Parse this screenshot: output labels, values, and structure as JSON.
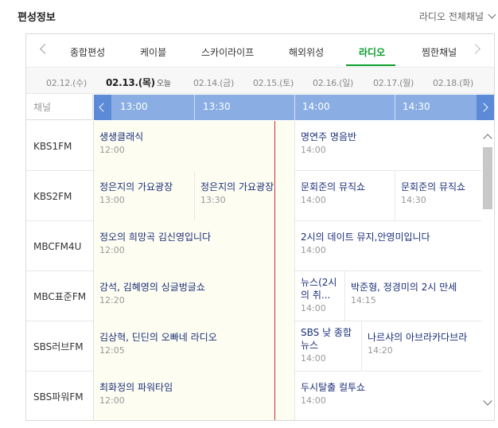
{
  "header": {
    "title": "편성정보",
    "channel_filter": "라디오 전체채널"
  },
  "tabs": [
    {
      "label": "종합편성",
      "active": false
    },
    {
      "label": "케이블",
      "active": false
    },
    {
      "label": "스카이라이프",
      "active": false
    },
    {
      "label": "해외위성",
      "active": false
    },
    {
      "label": "라디오",
      "active": true
    },
    {
      "label": "찜한채널",
      "active": false
    }
  ],
  "dates": [
    {
      "label": "02.12.(수)",
      "active": false,
      "today": ""
    },
    {
      "label": "02.13.(목)",
      "active": true,
      "today": "오늘"
    },
    {
      "label": "02.14.(금)",
      "active": false,
      "today": ""
    },
    {
      "label": "02.15.(토)",
      "active": false,
      "today": ""
    },
    {
      "label": "02.16.(일)",
      "active": false,
      "today": ""
    },
    {
      "label": "02.17.(월)",
      "active": false,
      "today": ""
    },
    {
      "label": "02.18.(화)",
      "active": false,
      "today": ""
    }
  ],
  "timebar": {
    "channel_header": "채널",
    "times": [
      "13:00",
      "13:30",
      "14:00",
      "14:30"
    ]
  },
  "channels": [
    {
      "name": "KBS1FM",
      "programs": [
        {
          "title": "생생클래식",
          "time": "12:00"
        },
        {
          "title": "명연주 명음반",
          "time": "14:00"
        }
      ]
    },
    {
      "name": "KBS2FM",
      "programs": [
        {
          "title": "정은지의 가요광장",
          "time": "13:00"
        },
        {
          "title": "정은지의 가요광장",
          "time": "13:30"
        },
        {
          "title": "문회준의 뮤직쇼",
          "time": "14:00"
        },
        {
          "title": "문회준의 뮤직쇼",
          "time": "14:30"
        }
      ]
    },
    {
      "name": "MBCFM4U",
      "programs": [
        {
          "title": "정오의 희망곡 김신영입니다",
          "time": "12:00"
        },
        {
          "title": "2시의 데이트 뮤지,안영미입니다",
          "time": "14:00"
        }
      ]
    },
    {
      "name": "MBC표준FM",
      "programs": [
        {
          "title": "강석, 김혜영의 싱글벙글쇼",
          "time": "12:20"
        },
        {
          "title": "뉴스(2시의 취...",
          "time": "14:00"
        },
        {
          "title": "박준형, 정경미의 2시 만세",
          "time": "14:15"
        }
      ]
    },
    {
      "name": "SBS러브FM",
      "programs": [
        {
          "title": "김상혁, 딘딘의 오빠네 라디오",
          "time": "12:05"
        },
        {
          "title": "SBS 낮 종합뉴스",
          "time": "14:00"
        },
        {
          "title": "나르샤의 아브라카다브라",
          "time": "14:20"
        }
      ]
    },
    {
      "name": "SBS파워FM",
      "programs": [
        {
          "title": "최화정의 파워타임",
          "time": "12:00"
        },
        {
          "title": "두시탈출 컬투쇼",
          "time": "14:00"
        }
      ]
    }
  ]
}
